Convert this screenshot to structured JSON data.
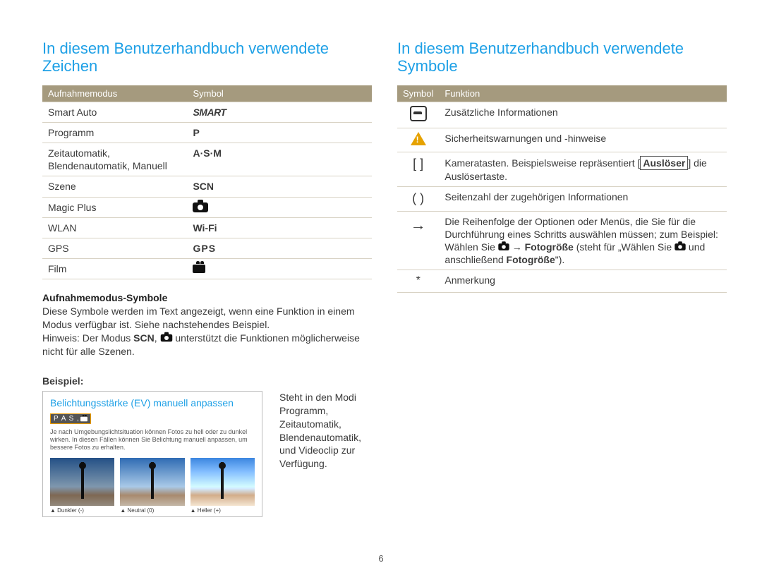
{
  "page_number": "6",
  "left": {
    "title": "In diesem Benutzerhandbuch verwendete Zeichen",
    "headers": [
      "Aufnahmemodus",
      "Symbol"
    ],
    "rows": [
      {
        "mode": "Smart Auto",
        "symbol": "SMART"
      },
      {
        "mode": "Programm",
        "symbol": "P"
      },
      {
        "mode": "Zeitautomatik, Blendenautomatik, Manuell",
        "symbol": "A·S·M"
      },
      {
        "mode": "Szene",
        "symbol": "SCN"
      },
      {
        "mode": "Magic Plus",
        "symbol": "[camera]"
      },
      {
        "mode": "WLAN",
        "symbol": "Wi-Fi"
      },
      {
        "mode": "GPS",
        "symbol": "GPS"
      },
      {
        "mode": "Film",
        "symbol": "[video]"
      }
    ],
    "sub_heading": "Aufnahmemodus-Symbole",
    "sub_text_1": "Diese Symbole werden im Text angezeigt, wenn eine Funktion in einem Modus verfügbar ist. Siehe nachstehendes Beispiel.",
    "sub_text_2_pre": "Hinweis: Der Modus ",
    "sub_text_2_mid": " unterstützt die Funktionen möglicherweise nicht für alle Szenen.",
    "example_label": "Beispiel:",
    "example": {
      "heading": "Belichtungsstärke (EV) manuell anpassen",
      "mode_tag": "P A S  ,",
      "body": "Je nach Umgebungslichtsituation können Fotos zu hell oder zu dunkel wirken. In diesen Fällen können Sie Belichtung manuell anpassen, um bessere Fotos zu erhalten.",
      "thumbs": [
        "▲ Dunkler (-)",
        "▲ Neutral (0)",
        "▲ Heller (+)"
      ]
    },
    "example_caption": "Steht in den Modi Programm, Zeitautomatik, Blendenautomatik, und Videoclip zur Verfügung."
  },
  "right": {
    "title": "In diesem Benutzerhandbuch verwendete Symbole",
    "headers": [
      "Symbol",
      "Funktion"
    ],
    "rows": [
      {
        "symbol_kind": "note",
        "text": "Zusätzliche Informationen"
      },
      {
        "symbol_kind": "warn",
        "text": "Sicherheitswarnungen und -hinweise"
      },
      {
        "symbol_kind": "brackets",
        "symbol_text": "[  ]",
        "text_pre": "Kameratasten. Beispielsweise repräsentiert [",
        "bold1": "Auslöser",
        "text_post": "] die Auslösertaste."
      },
      {
        "symbol_kind": "parens",
        "symbol_text": "(  )",
        "text": "Seitenzahl der zugehörigen Informationen"
      },
      {
        "symbol_kind": "arrow",
        "symbol_text": "→",
        "text_pre": "Die Reihenfolge der Optionen oder Menüs, die Sie für die Durchführung eines Schritts auswählen müssen; zum Beispiel: Wählen Sie ",
        "bold1": "Fotogröße",
        "text_mid": " (steht für „Wählen Sie ",
        "bold2": "Fotogröße",
        "text_post": "\")."
      },
      {
        "symbol_kind": "star",
        "symbol_text": "*",
        "text": "Anmerkung"
      }
    ]
  }
}
